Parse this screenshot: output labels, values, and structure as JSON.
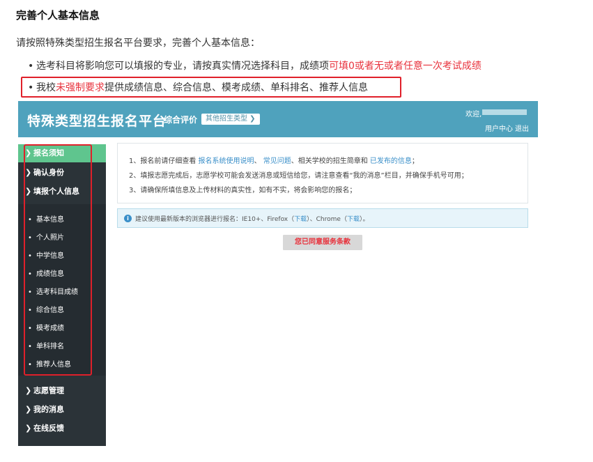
{
  "doc": {
    "title": "完善个人基本信息",
    "intro": "请按照特殊类型招生报名平台要求，完善个人基本信息：",
    "bullet1_plain": "选考科目将影响您可以填报的专业，请按真实情况选择科目，成绩项",
    "bullet1_red": "可填0或者无或者任意一次考试成绩",
    "bullet2_a": "我校",
    "bullet2_red": "未强制要求",
    "bullet2_b": "提供成绩信息、综合信息、模考成绩、单科排名、推荐人信息"
  },
  "app": {
    "title": "特殊类型招生报名平台",
    "subtitle": "综合评价",
    "type_button": "其他招生类型 ❯",
    "welcome": "欢迎,",
    "user_center": "用户中心",
    "logout": "退出"
  },
  "sidebar": {
    "main_items": [
      {
        "label": "报名须知"
      },
      {
        "label": "确认身份"
      },
      {
        "label": "填报个人信息"
      }
    ],
    "sub_items": [
      {
        "label": "基本信息"
      },
      {
        "label": "个人照片"
      },
      {
        "label": "中学信息"
      },
      {
        "label": "成绩信息"
      },
      {
        "label": "选考科目成绩"
      },
      {
        "label": "综合信息"
      },
      {
        "label": "模考成绩"
      },
      {
        "label": "单科排名"
      },
      {
        "label": "推荐人信息"
      }
    ],
    "bottom_items": [
      {
        "label": "志愿管理"
      },
      {
        "label": "我的消息"
      },
      {
        "label": "在线反馈"
      }
    ]
  },
  "notice": {
    "line1_a": "1、报名前请仔细查看 ",
    "line1_link1": "报名系统使用说明",
    "line1_sep": "、 ",
    "line1_link2": "常见问题",
    "line1_b": "、相关学校的招生简章和 ",
    "line1_link3": "已发布的信息",
    "line1_c": "；",
    "line2": "2、填报志愿完成后，志愿学校可能会发送消息或短信给您，请注意查看“我的消息”栏目，并确保手机号可用；",
    "line3": "3、请确保所填信息及上传材料的真实性，如有不实，将会影响您的报名；"
  },
  "tip": {
    "text_a": "建议使用最新版本的浏览器进行报名：IE10+、Firefox（",
    "download1": "下载",
    "text_b": "）、Chrome（",
    "download2": "下载",
    "text_c": "）。"
  },
  "agree_button": "您已同意服务条款",
  "colors": {
    "header": "#4fa2bd",
    "sidebar": "#2b3338",
    "active": "#5fc58e",
    "highlight": "#e0202a",
    "accent_red": "#e8323c",
    "link": "#3a8fc9"
  }
}
